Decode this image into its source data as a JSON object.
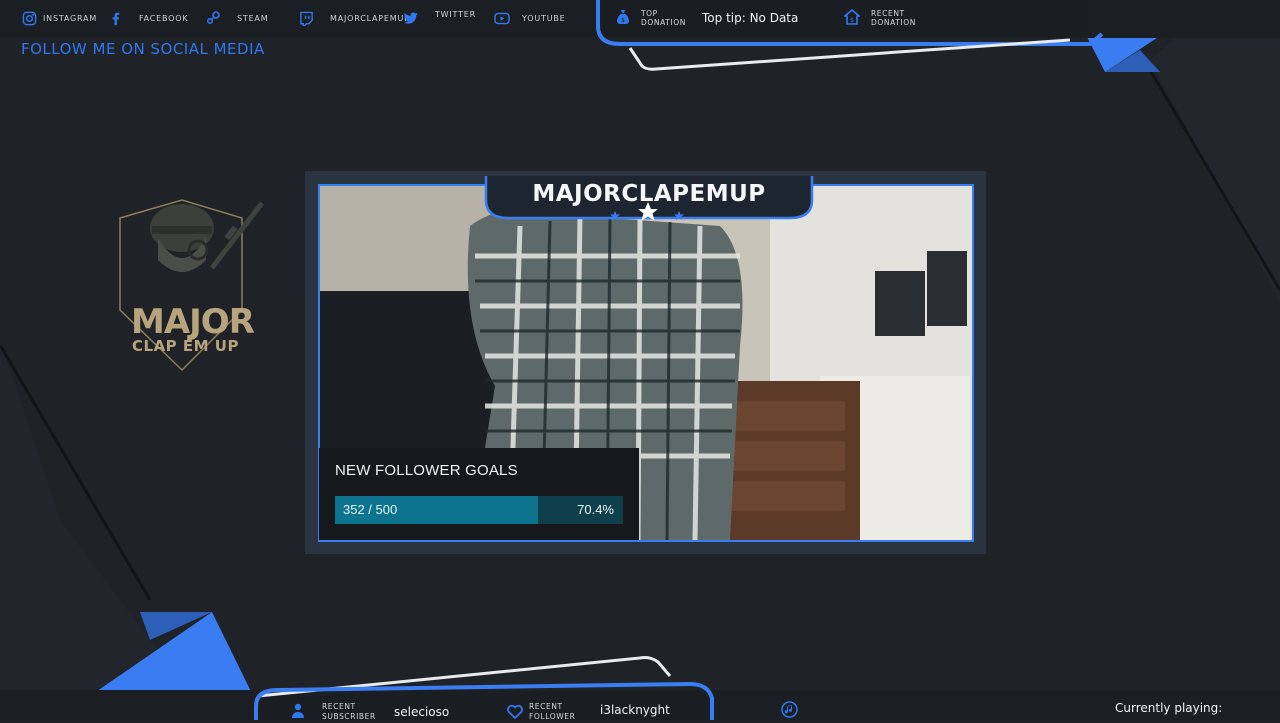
{
  "social": {
    "items": [
      {
        "label": "instagram",
        "icon": "instagram-icon"
      },
      {
        "label": "facebook",
        "icon": "facebook-icon"
      },
      {
        "label": "steam",
        "icon": "steam-icon"
      },
      {
        "label": "majorclapemup",
        "icon": "twitch-icon"
      },
      {
        "label": "twitter",
        "icon": "twitter-icon"
      },
      {
        "label": "youtube",
        "icon": "youtube-icon"
      }
    ],
    "follow_text": "FOLLOW ME ON SOCIAL MEDIA"
  },
  "top_panel": {
    "top_donation_label_1": "TOP",
    "top_donation_label_2": "DONATION",
    "top_tip": "Top tip: No Data",
    "recent_donation_label_1": "RECENT",
    "recent_donation_label_2": "DONATION"
  },
  "logo": {
    "line1": "MAJOR",
    "line2": "CLAP EM UP"
  },
  "camera": {
    "name": "MAJORCLAPEMUP"
  },
  "goal": {
    "title": "NEW FOLLOWER GOALS",
    "count_text": "352 / 500",
    "percent_text": "70.4%",
    "progress": 0.704
  },
  "bottom": {
    "recent_subscriber_label_1": "RECENT",
    "recent_subscriber_label_2": "SUBSCRIBER",
    "recent_subscriber": "selecioso",
    "recent_follower_label_1": "RECENT",
    "recent_follower_label_2": "FOLLOWER",
    "recent_follower": "i3lacknyght",
    "now_playing": "Currently playing:"
  },
  "colors": {
    "accent": "#2f78f0",
    "background": "#1f2227",
    "goal_fill": "#0d7490",
    "logo_gold": "#b8a47c"
  }
}
